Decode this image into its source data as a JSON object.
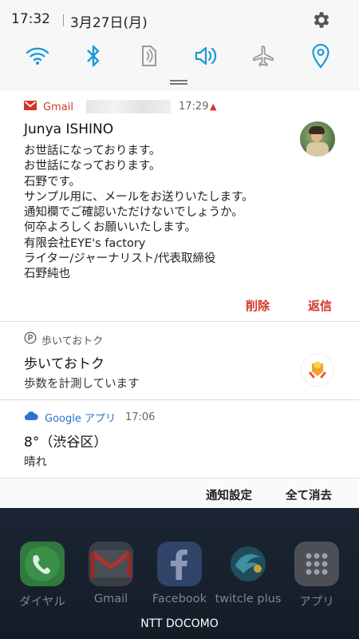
{
  "status_bar": {
    "time": "17:32",
    "date": "3月27日(月)"
  },
  "quick_settings": {
    "tiles": [
      "wifi-icon",
      "bluetooth-icon",
      "nfc-icon",
      "sound-icon",
      "airplane-mode-icon",
      "location-icon"
    ],
    "accent": "#1a9bd7"
  },
  "notifications": {
    "gmail": {
      "app_name": "Gmail",
      "time": "17:29",
      "sender": "Junya ISHINO",
      "subject": "お世話になっております。",
      "body_lines": [
        "お世話になっております。",
        "石野です。",
        "サンプル用に、メールをお送りいたします。",
        "通知欄でご確認いただけないでしょうか。",
        "何卒よろしくお願いいたします。",
        "有限会社EYE's factory",
        "ライター/ジャーナリスト/代表取締役",
        "石野純也"
      ],
      "actions": {
        "delete": "削除",
        "reply": "返信"
      },
      "accent": "#d2362b"
    },
    "walk": {
      "app_name": "歩いておトク",
      "title": "歩いておトク",
      "text": "歩数を計測しています"
    },
    "google": {
      "app_name": "Google アプリ",
      "time": "17:06",
      "title": "8°（渋谷区）",
      "text": "晴れ",
      "accent": "#2b72d6"
    }
  },
  "panel_footer": {
    "settings": "通知設定",
    "clear_all": "全て消去"
  },
  "dock": {
    "apps": [
      {
        "label": "ダイヤル",
        "icon": "phone-icon"
      },
      {
        "label": "Gmail",
        "icon": "gmail-icon"
      },
      {
        "label": "Facebook",
        "icon": "facebook-icon"
      },
      {
        "label": "twitcle plus",
        "icon": "twitcle-plus-icon"
      },
      {
        "label": "アプリ",
        "icon": "app-drawer-icon"
      }
    ],
    "carrier": "NTT DOCOMO"
  }
}
